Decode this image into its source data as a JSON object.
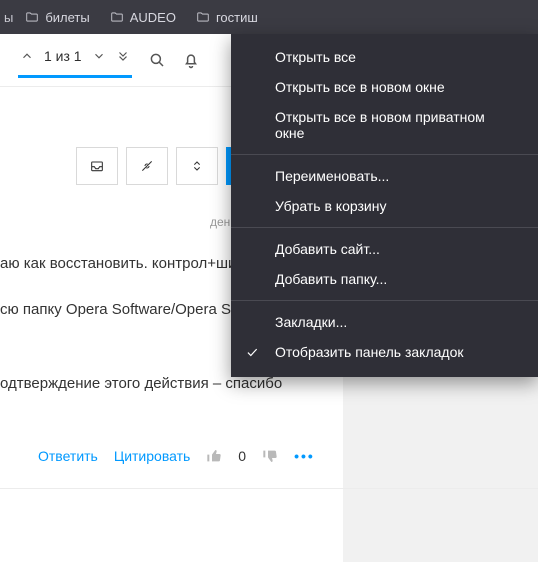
{
  "bookmarks_bar": {
    "partial_prefix": "ы",
    "items": [
      {
        "label": "билеты"
      },
      {
        "label": "AUDEO"
      },
      {
        "label": "гостиш",
        "truncated": true
      }
    ]
  },
  "search_toolbar": {
    "counter": "1 из 1"
  },
  "context_menu": {
    "groups": [
      [
        "Открыть все",
        "Открыть все в новом окне",
        "Открыть все в новом приватном окне"
      ],
      [
        "Переименовать...",
        "Убрать в корзину"
      ],
      [
        "Добавить сайт...",
        "Добавить папку..."
      ],
      [
        "Закладки..."
      ]
    ],
    "checked_item": "Отобразить панель закладок"
  },
  "post": {
    "time_ago_fragment": "день назад",
    "line1": "аю как восстановить. контрол+шифт+т",
    "line2": "сю папку Opera Software/Opera Stable.",
    "line3": "одтверждение этого действия – спасибо",
    "actions": {
      "reply": "Ответить",
      "quote": "Цитировать",
      "score": "0"
    }
  }
}
